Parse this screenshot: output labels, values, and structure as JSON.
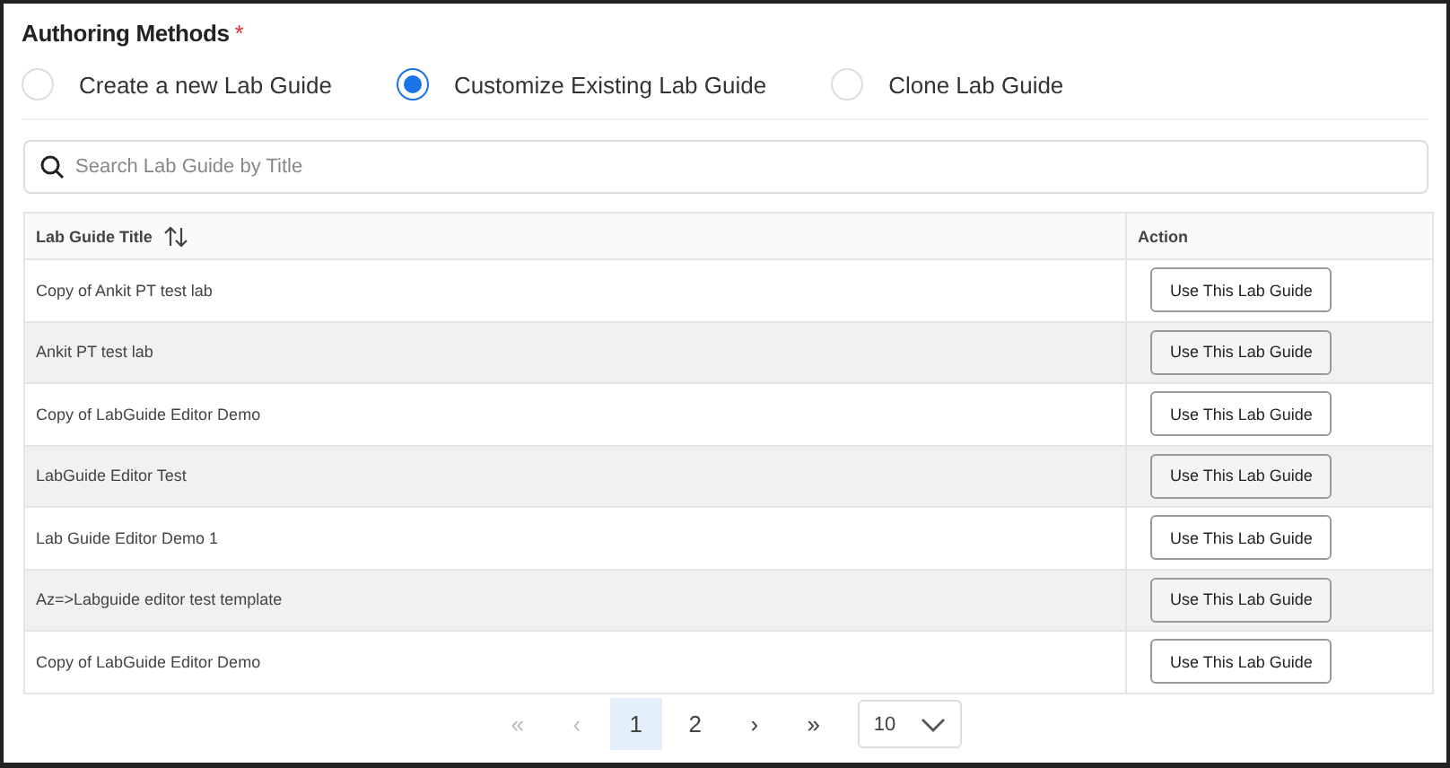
{
  "section": {
    "title": "Authoring Methods",
    "required_mark": "*"
  },
  "methods": [
    {
      "label": "Create a new Lab Guide",
      "selected": false
    },
    {
      "label": "Customize Existing Lab Guide",
      "selected": true
    },
    {
      "label": "Clone Lab Guide",
      "selected": false
    }
  ],
  "search": {
    "placeholder": "Search Lab Guide by Title"
  },
  "table": {
    "columns": [
      "Lab Guide Title",
      "Action"
    ],
    "rows": [
      {
        "title": "Copy of Ankit PT test lab",
        "action": "Use This Lab Guide"
      },
      {
        "title": "Ankit PT test lab",
        "action": "Use This Lab Guide"
      },
      {
        "title": "Copy of LabGuide Editor Demo",
        "action": "Use This Lab Guide"
      },
      {
        "title": "LabGuide Editor Test",
        "action": "Use This Lab Guide"
      },
      {
        "title": "Lab Guide Editor Demo 1",
        "action": "Use This Lab Guide"
      },
      {
        "title": "Az=>Labguide editor test template",
        "action": "Use This Lab Guide"
      },
      {
        "title": "Copy of LabGuide Editor Demo",
        "action": "Use This Lab Guide"
      }
    ]
  },
  "pagination": {
    "first": {
      "label": "«",
      "disabled": true
    },
    "prev": {
      "label": "‹",
      "disabled": true
    },
    "pages": [
      {
        "label": "1",
        "selected": true
      },
      {
        "label": "2",
        "selected": false
      }
    ],
    "next": {
      "label": "›",
      "disabled": false
    },
    "last": {
      "label": "»",
      "disabled": false
    },
    "page_size": "10"
  }
}
